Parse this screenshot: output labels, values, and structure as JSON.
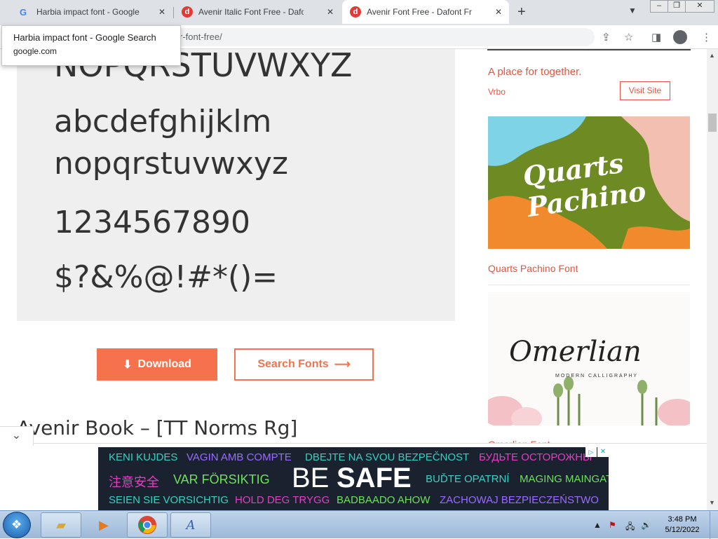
{
  "browser": {
    "tabs": [
      {
        "title": "Harbia impact font - Google Search",
        "favicon": "google-icon"
      },
      {
        "title": "Avenir Italic Font Free - Dafont Fr",
        "favicon": "dafont-icon"
      },
      {
        "title": "Avenir Font Free - Dafont Free",
        "favicon": "dafont-icon"
      }
    ],
    "active_tab": 2,
    "url_fragment": "r-font-free/",
    "tooltip": {
      "title": "Harbia impact font - Google Search",
      "domain": "google.com"
    }
  },
  "preview": {
    "uppercase_tail": "NOPQRSTUVWXYZ",
    "lowercase_1": "abcdefghijklm",
    "lowercase_2": "nopqrstuvwxyz",
    "digits": "1234567890",
    "symbols": "$?&%@!#*()="
  },
  "actions": {
    "download": "Download",
    "search_fonts": "Search Fonts"
  },
  "section_heading": "Avenir Book – [TT Norms Rg]",
  "sidebar": {
    "ad_tagline": "A place for together.",
    "ad_brand": "Vrbo",
    "ad_button": "Visit Site",
    "items": [
      {
        "thumb_text": "Quarts Pachino",
        "label": "Quarts Pachino Font"
      },
      {
        "thumb_text": "Omerlian",
        "thumb_sub": "MODERN CALLIGRAPHY",
        "label": "Omerlian Font"
      }
    ]
  },
  "banner": {
    "rows": [
      [
        "KENI KUJDES",
        "VAGIN AMB COMPTE",
        "DBEJTE NA SVOU BEZPEČNOST",
        "БУДЬТЕ ОСТОРОЖНЫ"
      ],
      [
        "注意安全",
        "VAR FÖRSIKTIG",
        "BUĎTE OPATRNÍ",
        "MAGING MAINGAT"
      ],
      [
        "SEIEN SIE VORSICHTIG",
        "HOLD DEG TRYGG",
        "BADBAADO AHOW",
        "ZACHOWAJ BEZPIECZEŃSTWO"
      ]
    ],
    "headline_be": "BE",
    "headline_safe": "SAFE"
  },
  "taskbar": {
    "time": "3:48 PM",
    "date": "5/12/2022",
    "apps": [
      "explorer-icon",
      "media-player-icon",
      "chrome-icon",
      "font-app-icon"
    ]
  },
  "colors": {
    "accent": "#f6724c",
    "link": "#e8533f"
  }
}
